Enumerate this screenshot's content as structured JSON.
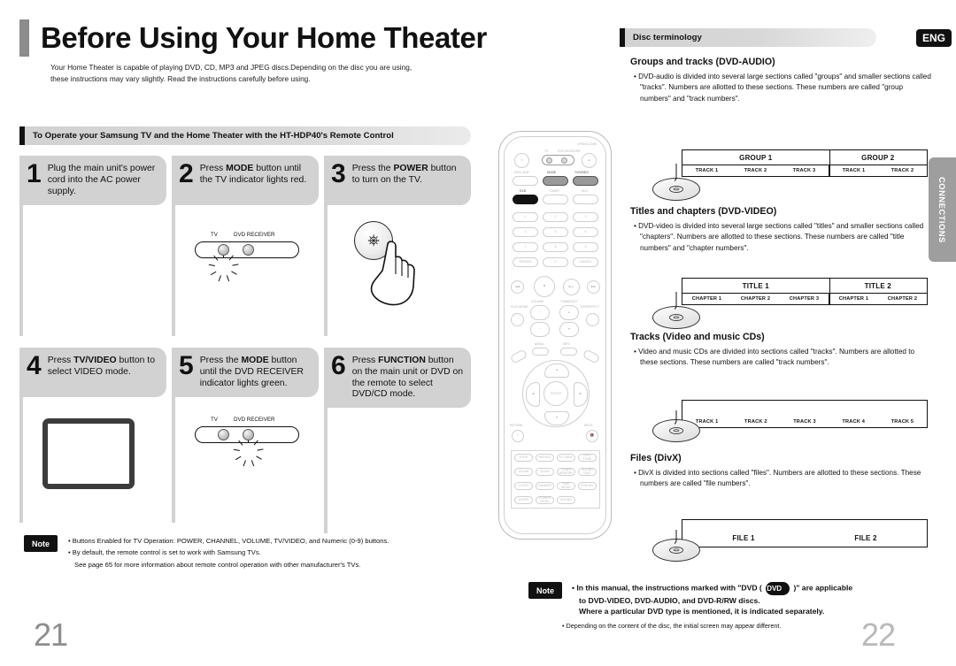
{
  "left": {
    "title": "Before Using Your Home Theater",
    "intro": "Your Home Theater is capable of playing DVD, CD, MP3 and JPEG discs.Depending on the disc you are using, these instructions may vary slightly. Read the instructions carefully before using.",
    "banner": "To Operate your Samsung TV and the Home Theater with the HT-HDP40's Remote Control",
    "steps": [
      {
        "num": "1",
        "text": "Plug the main unit's power cord into the AC power supply."
      },
      {
        "num": "2",
        "text_pre": "Press ",
        "bold": "MODE",
        "text_post": " button until the TV indicator lights red."
      },
      {
        "num": "3",
        "text_pre": "Press the ",
        "bold": "POWER",
        "text_post": " button to turn on the TV."
      },
      {
        "num": "4",
        "text_pre": "Press ",
        "bold": "TV/VIDEO",
        "text_post": " button to select VIDEO mode."
      },
      {
        "num": "5",
        "text_pre": "Press the ",
        "bold": "MODE",
        "text_post": " button until the DVD RECEIVER indicator lights green."
      },
      {
        "num": "6",
        "text_pre": "Press ",
        "bold": "FUNCTION",
        "text_post": " button on the main unit or DVD on the remote to select DVD/CD mode."
      }
    ],
    "indicator_labels": {
      "tv": "TV",
      "dvd": "DVD RECEIVER"
    },
    "note": {
      "badge": "Note",
      "line1": "• Buttons Enabled for TV Operation: POWER, CHANNEL, VOLUME, TV/VIDEO, and Numeric (0-9) buttons.",
      "line2": "• By default, the remote control is set to work with Samsung TVs.",
      "line3": "See page 65 for more information about remote control operation with other manufacturer's TVs."
    },
    "page_number": "21"
  },
  "remote": {
    "labels": {
      "open_close": "OPEN/CLOSE",
      "disc_skip": "DISC SKIP",
      "mode": "MODE",
      "tv_video": "TV/VIDEO",
      "dvd": "DVD",
      "tuner": "TUNER",
      "aux": "AUX",
      "tv": "TV",
      "dvd_receiver": "DVD RECEIVER",
      "volume": "VOLUME",
      "tuning_ch": "TUNING/CH",
      "return": "RETURN",
      "mute": "MUTE",
      "enter": "ENTER",
      "play_mode": "PLAY MODE",
      "dsp_effect": "DSP/EFFECT",
      "menu": "MENU",
      "info": "INFO"
    },
    "numeric": [
      "1",
      "2",
      "3",
      "4",
      "5",
      "6",
      "7",
      "8",
      "9",
      "REMAIN",
      "0",
      "CANCEL"
    ],
    "function_buttons": [
      "STEP",
      "REPEAT",
      "EZ VIEW",
      "TEST TONE",
      "ZOOM",
      "SLOW",
      "TUNER MEMORY",
      "SOUND EDIT",
      "LOGO",
      "DIMMER",
      "SIDE MODE",
      "P.SCAN",
      "SLEEP",
      "POWER LEVEL",
      "SOUND"
    ]
  },
  "right": {
    "eng_badge": "ENG",
    "banner": "Disc terminology",
    "connections_tab": "CONNECTIONS",
    "sections": [
      {
        "title": "Groups and tracks (DVD-AUDIO)",
        "body": "• DVD-audio is divided into several large sections called \"groups\" and smaller sections called \"tracks\". Numbers are allotted to these sections. These numbers are called \"group numbers\" and \"track numbers\"."
      },
      {
        "title": "Titles and chapters (DVD-VIDEO)",
        "body": "• DVD-video is divided into several large sections called \"titles\" and smaller sections called \"chapters\". Numbers are allotted to these sections. These numbers are called \"title numbers\" and \"chapter numbers\"."
      },
      {
        "title": "Tracks (Video and music CDs)",
        "body": "• Video and music CDs are divided into sections called \"tracks\". Numbers are allotted to these sections. These numbers are called \"track numbers\"."
      },
      {
        "title": "Files (DivX)",
        "body": "• DivX is divided into sections called \"files\". Numbers are allotted to these sections. These numbers are called \"file numbers\"."
      }
    ],
    "note": {
      "badge": "Note",
      "line1_pre": "• In this manual, the instructions marked with \"DVD ( ",
      "chip": "DVD",
      "line1_post": " )\" are applicable",
      "line2": "to DVD-VIDEO, DVD-AUDIO, and DVD-R/RW discs.",
      "line3": "Where a particular DVD type is mentioned, it is indicated separately.",
      "line4": "• Depending on the content of the disc, the initial screen may appear different."
    },
    "page_number": "22"
  },
  "chart_data": {
    "type": "table",
    "title": "Disc terminology structure diagrams",
    "diagrams": [
      {
        "name": "dvd-audio-groups-tracks",
        "top_row": [
          {
            "label": "GROUP 1",
            "span": 3
          },
          {
            "label": "GROUP 2",
            "span": 2
          }
        ],
        "bottom_row": [
          "TRACK 1",
          "TRACK 2",
          "TRACK 3",
          "TRACK 1",
          "TRACK 2"
        ]
      },
      {
        "name": "dvd-video-titles-chapters",
        "top_row": [
          {
            "label": "TITLE 1",
            "span": 3
          },
          {
            "label": "TITLE 2",
            "span": 2
          }
        ],
        "bottom_row": [
          "CHAPTER 1",
          "CHAPTER 2",
          "CHAPTER 3",
          "CHAPTER 1",
          "CHAPTER 2"
        ]
      },
      {
        "name": "cd-tracks",
        "top_row": [],
        "bottom_row": [
          "TRACK 1",
          "TRACK 2",
          "TRACK 3",
          "TRACK 4",
          "TRACK 5"
        ]
      },
      {
        "name": "divx-files",
        "top_row": [],
        "bottom_row": [
          "FILE 1",
          "FILE 2"
        ]
      }
    ]
  }
}
